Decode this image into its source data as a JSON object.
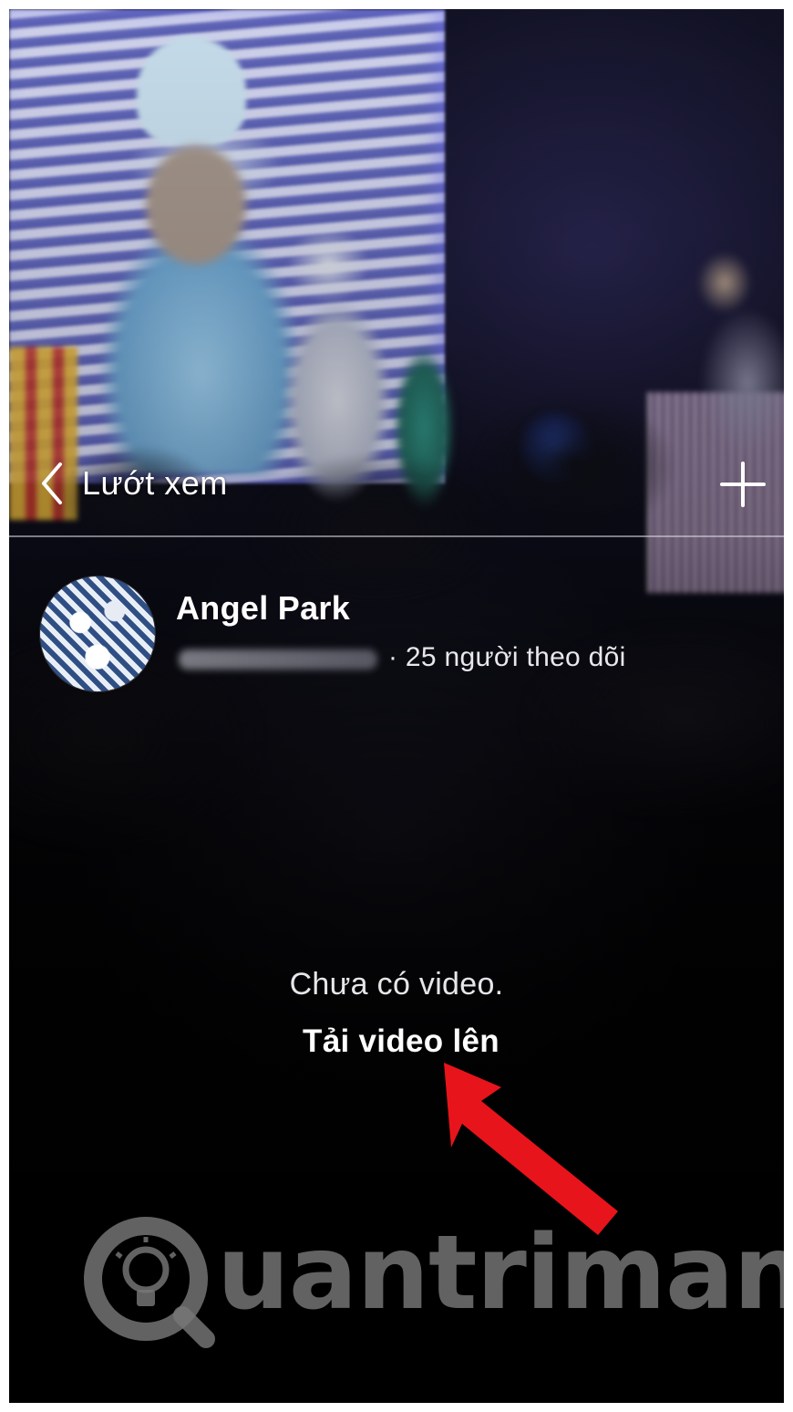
{
  "nav": {
    "back_label": "Lướt xem",
    "back_icon": "chevron-left-icon",
    "add_icon": "plus-icon"
  },
  "profile": {
    "name": "Angel Park",
    "followers": "· 25 người theo dõi"
  },
  "empty_state": {
    "message": "Chưa có video.",
    "upload_label": "Tải video lên"
  },
  "annotation": {
    "arrow_color": "#e8141b"
  },
  "watermark": {
    "text": "uantrimang"
  },
  "colors": {
    "text_primary": "#ffffff",
    "divider": "#dcdce6",
    "background": "#07070b"
  }
}
